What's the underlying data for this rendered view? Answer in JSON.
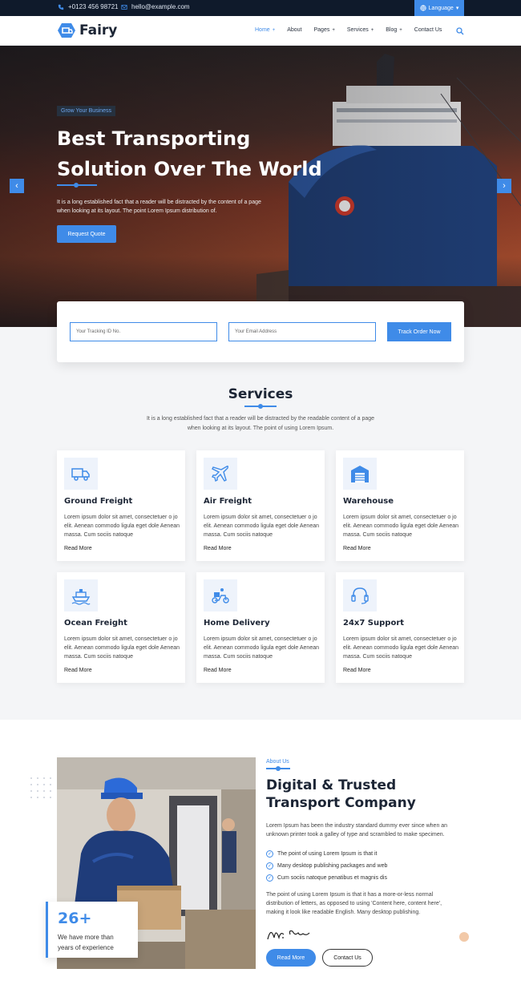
{
  "topbar": {
    "phone": "+0123 456 98721",
    "email": "hello@example.com",
    "language": "Language"
  },
  "header": {
    "logo": "Fairy",
    "nav": [
      {
        "label": "Home",
        "has_caret": true,
        "active": true
      },
      {
        "label": "About",
        "has_caret": false,
        "active": false
      },
      {
        "label": "Pages",
        "has_caret": true,
        "active": false
      },
      {
        "label": "Services",
        "has_caret": true,
        "active": false
      },
      {
        "label": "Blog",
        "has_caret": true,
        "active": false
      },
      {
        "label": "Contact Us",
        "has_caret": false,
        "active": false
      }
    ]
  },
  "hero": {
    "badge": "Grow Your Business",
    "title": "Best Transporting Solution Over The World",
    "text": "It is a long established fact that a reader will be distracted by the content of a page when looking at its layout. The point Lorem Ipsum distribution of.",
    "cta": "Request Quote"
  },
  "tracking": {
    "id_placeholder": "Your Tracking ID No.",
    "email_placeholder": "Your Email Address",
    "button": "Track Order Now"
  },
  "services": {
    "title": "Services",
    "description": "It is a long established fact that a reader will be distracted by the readable content of a page when looking at its layout. The point of using Lorem Ipsum.",
    "items": [
      {
        "title": "Ground Freight",
        "icon": "truck-icon",
        "text": "Lorem ipsum dolor sit amet, consectetuer o jo elit. Aenean commodo ligula eget dole Aenean massa. Cum sociis natoque",
        "more": "Read More"
      },
      {
        "title": "Air Freight",
        "icon": "airplane-icon",
        "text": "Lorem ipsum dolor sit amet, consectetuer o jo elit. Aenean commodo ligula eget dole Aenean massa. Cum sociis natoque",
        "more": "Read More"
      },
      {
        "title": "Warehouse",
        "icon": "warehouse-icon",
        "text": "Lorem ipsum dolor sit amet, consectetuer o jo elit. Aenean commodo ligula eget dole Aenean massa. Cum sociis natoque",
        "more": "Read More"
      },
      {
        "title": "Ocean Freight",
        "icon": "ship-icon",
        "text": "Lorem ipsum dolor sit amet, consectetuer o jo elit. Aenean commodo ligula eget dole Aenean massa. Cum sociis natoque",
        "more": "Read More"
      },
      {
        "title": "Home Delivery",
        "icon": "scooter-icon",
        "text": "Lorem ipsum dolor sit amet, consectetuer o jo elit. Aenean commodo ligula eget dole Aenean massa. Cum sociis natoque",
        "more": "Read More"
      },
      {
        "title": "24x7 Support",
        "icon": "headset-icon",
        "text": "Lorem ipsum dolor sit amet, consectetuer o jo elit. Aenean commodo ligula eget dole Aenean massa. Cum sociis natoque",
        "more": "Read More"
      }
    ]
  },
  "about": {
    "label": "About Us",
    "title": "Digital & Trusted Transport Company",
    "text": "Lorem Ipsum has been the industry standard dummy ever since when an unknown printer took a galley of type and scrambled to make specimen.",
    "checks": [
      "The point of using Lorem Ipsum is that it",
      "Many desktop publishing packages and web",
      "Cum sociis natoque penatibus et magnis dis"
    ],
    "text2": "The point of using Lorem Ipsum is that it has a more-or-less normal distribution of letters, as opposed to using 'Content here, content here', making it look like readable English. Many desktop publishing.",
    "experience_number": "26+",
    "experience_text": "We have more than years of experience",
    "read_more": "Read More",
    "contact": "Contact Us"
  },
  "colors": {
    "accent": "#3f8be8",
    "dark": "#1c2535",
    "topbar": "#0f1a2b"
  }
}
